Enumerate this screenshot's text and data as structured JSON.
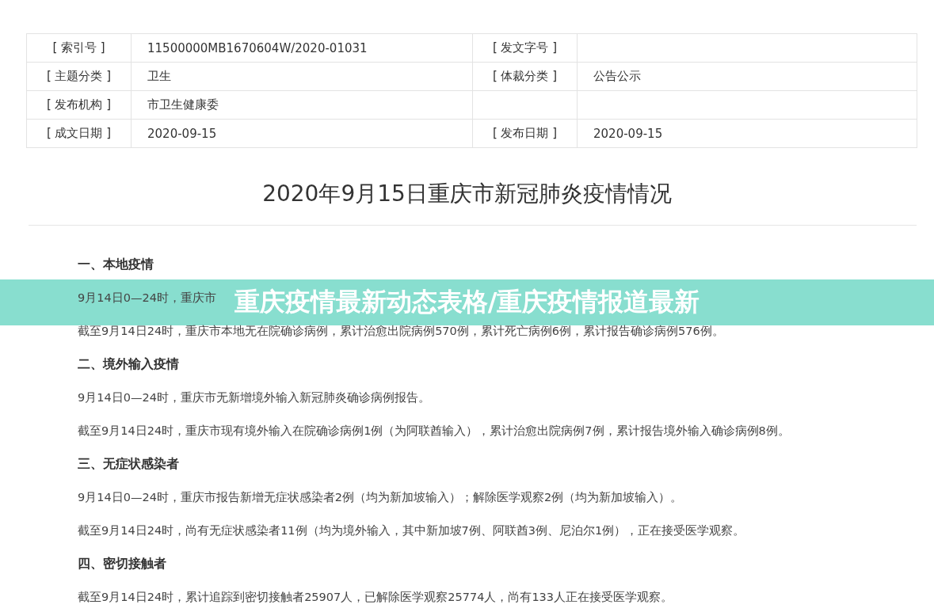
{
  "meta_table": {
    "rows": [
      {
        "cells": [
          "[ 索引号 ]",
          "11500000MB1670604W/2020-01031",
          "[ 发文字号 ]",
          ""
        ]
      },
      {
        "cells": [
          "[ 主题分类 ]",
          "卫生",
          "[ 体裁分类 ]",
          "公告公示"
        ]
      },
      {
        "cells": [
          "[ 发布机构 ]",
          "市卫生健康委",
          "",
          ""
        ]
      },
      {
        "cells": [
          "[ 成文日期 ]",
          "2020-09-15",
          "[ 发布日期 ]",
          "2020-09-15"
        ]
      }
    ]
  },
  "article": {
    "title": "2020年9月15日重庆市新冠肺炎疫情情况",
    "sections": [
      {
        "heading": "一、本地疫情",
        "paragraphs": [
          "9月14日0—24时，重庆市",
          "截至9月14日24时，重庆市本地无在院确诊病例，累计治愈出院病例570例，累计死亡病例6例，累计报告确诊病例576例。"
        ]
      },
      {
        "heading": "二、境外输入疫情",
        "paragraphs": [
          "9月14日0—24时，重庆市无新增境外输入新冠肺炎确诊病例报告。",
          "截至9月14日24时，重庆市现有境外输入在院确诊病例1例（为阿联酋输入），累计治愈出院病例7例，累计报告境外输入确诊病例8例。"
        ]
      },
      {
        "heading": "三、无症状感染者",
        "paragraphs": [
          "9月14日0—24时，重庆市报告新增无症状感染者2例（均为新加坡输入）；解除医学观察2例（均为新加坡输入）。",
          "截至9月14日24时，尚有无症状感染者11例（均为境外输入，其中新加坡7例、阿联酋3例、尼泊尔1例），正在接受医学观察。"
        ]
      },
      {
        "heading": "四、密切接触者",
        "paragraphs": [
          "截至9月14日24时，累计追踪到密切接触者25907人，已解除医学观察25774人，尚有133人正在接受医学观察。"
        ]
      }
    ]
  },
  "banner": {
    "text": "重庆疫情最新动态表格/重庆疫情报道最新"
  }
}
